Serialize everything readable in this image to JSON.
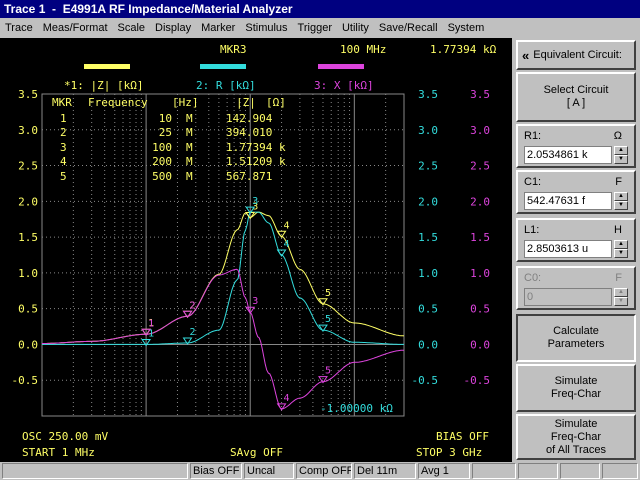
{
  "window": {
    "title": "Trace 1  -  E4991A RF Impedance/Material Analyzer"
  },
  "menu": [
    "Trace",
    "Meas/Format",
    "Scale",
    "Display",
    "Marker",
    "Stimulus",
    "Trigger",
    "Utility",
    "Save/Recall",
    "System"
  ],
  "colors": {
    "trace1": "#ffff66",
    "trace2": "#33dddd",
    "trace3": "#dd44dd",
    "grid": "#888888",
    "text": "#ffff66",
    "background": "#000000"
  },
  "header": {
    "active_marker": "MKR3",
    "marker_freq": "100 MHz",
    "marker_value": "1.77394 kΩ"
  },
  "traces": [
    {
      "label": "*1: |Z| [kΩ]",
      "color": "#ffff66"
    },
    {
      "label": "2: R [kΩ]",
      "color": "#33dddd"
    },
    {
      "label": "3: X [kΩ]",
      "color": "#dd44dd"
    }
  ],
  "marker_table": {
    "headers": [
      "MKR",
      "Frequency",
      "[Hz]",
      "|Z|",
      "[Ω]"
    ],
    "rows": [
      {
        "n": "1",
        "freq": "10",
        "unit": "M",
        "value": "142.904"
      },
      {
        "n": "2",
        "freq": "25",
        "unit": "M",
        "value": "394.010"
      },
      {
        "n": "3",
        "freq": "100",
        "unit": "M",
        "value": "1.77394 k"
      },
      {
        "n": "4",
        "freq": "200",
        "unit": "M",
        "value": "1.51209 k"
      },
      {
        "n": "5",
        "freq": "500",
        "unit": "M",
        "value": "567.871"
      }
    ]
  },
  "axes": {
    "left_ticks": [
      "3.5",
      "3.0",
      "2.5",
      "2.0",
      "1.5",
      "1.0",
      "0.5",
      "0.0",
      "-0.5"
    ],
    "mid_ticks": [
      "3.5",
      "3.0",
      "2.5",
      "2.0",
      "1.5",
      "1.0",
      "0.5",
      "0.0",
      "-0.5"
    ],
    "right_ticks": [
      "3.5",
      "3.0",
      "2.5",
      "2.0",
      "1.5",
      "1.0",
      "0.5",
      "0.0",
      "-0.5"
    ],
    "trace3_bottom_label": "-1.00000 kΩ",
    "y_range": [
      -1.0,
      3.5
    ],
    "x_log_range_hz": [
      1000000.0,
      3000000000.0
    ]
  },
  "footer": {
    "osc": "OSC 250.00 mV",
    "bias": "BIAS OFF",
    "start": "START  1 MHz",
    "savg": "SAvg OFF",
    "stop": "STOP  3 GHz"
  },
  "panel": {
    "header": "Equivalent Circuit:",
    "back_arrow": "«",
    "select_circuit": "Select Circuit\n[ A ]",
    "params": [
      {
        "label": "R1:",
        "unit": "Ω",
        "value": "2.0534861 k",
        "enabled": true
      },
      {
        "label": "C1:",
        "unit": "F",
        "value": "542.47631 f",
        "enabled": true
      },
      {
        "label": "L1:",
        "unit": "H",
        "value": "2.8503613 u",
        "enabled": true
      },
      {
        "label": "C0:",
        "unit": "F",
        "value": "0",
        "enabled": false
      }
    ],
    "calculate": "Calculate\nParameters",
    "simulate": "Simulate\nFreq-Char",
    "simulate_all": "Simulate\nFreq-Char\nof All Traces"
  },
  "status": [
    "Bias OFF",
    "Uncal",
    "Comp OFF",
    "Del 11m",
    "Avg  1"
  ],
  "chart_data": {
    "type": "line",
    "x_scale": "log",
    "x_unit": "Hz",
    "xlim": [
      1000000,
      3000000000
    ],
    "ylim": [
      -1.0,
      3.5
    ],
    "series": [
      {
        "name": "|Z| [kΩ]",
        "color": "#ffff66",
        "x": [
          1000000,
          3000000,
          10000000,
          25000000,
          50000000,
          75000000,
          90000000,
          100000000,
          120000000,
          150000000,
          200000000,
          300000000,
          500000000,
          1000000000,
          3000000000
        ],
        "values": [
          0.013,
          0.043,
          0.143,
          0.394,
          0.98,
          1.6,
          1.84,
          1.774,
          1.85,
          1.8,
          1.512,
          1.05,
          0.568,
          0.3,
          0.12
        ]
      },
      {
        "name": "R [kΩ]",
        "color": "#33dddd",
        "x": [
          1000000,
          3000000,
          10000000,
          25000000,
          50000000,
          75000000,
          90000000,
          100000000,
          120000000,
          150000000,
          200000000,
          300000000,
          500000000,
          1000000000,
          3000000000
        ],
        "values": [
          0.0,
          0.0,
          0.0,
          0.02,
          0.2,
          0.9,
          1.6,
          1.85,
          1.85,
          1.7,
          1.25,
          0.65,
          0.2,
          0.03,
          0.0
        ]
      },
      {
        "name": "X [kΩ]",
        "color": "#dd44dd",
        "x": [
          1000000,
          3000000,
          10000000,
          25000000,
          50000000,
          75000000,
          90000000,
          100000000,
          120000000,
          150000000,
          200000000,
          300000000,
          500000000,
          1000000000,
          3000000000
        ],
        "values": [
          0.013,
          0.043,
          0.142,
          0.394,
          0.97,
          1.05,
          0.65,
          0.45,
          0.1,
          -0.4,
          -0.9,
          -0.75,
          -0.52,
          -0.25,
          -0.08
        ]
      }
    ],
    "markers": [
      {
        "n": "1",
        "x": 10000000
      },
      {
        "n": "2",
        "x": 25000000
      },
      {
        "n": "3",
        "x": 100000000
      },
      {
        "n": "4",
        "x": 200000000
      },
      {
        "n": "5",
        "x": 500000000
      }
    ]
  }
}
